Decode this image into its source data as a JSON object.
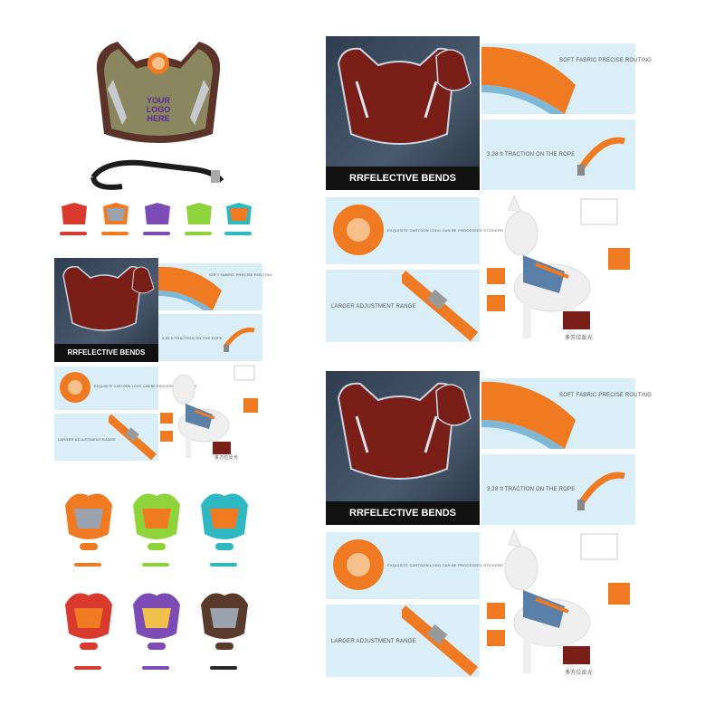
{
  "product": {
    "logo_badge": [
      "YOUR",
      "LOGO",
      "HERE"
    ]
  },
  "detail_panel": {
    "reflective_label": "RRFELECTIVE BENDS",
    "fabric_label": "SOFT FABRIC PRECISE ROUTING",
    "traction_label": "3.28 ft TRACTION ON THE ROPE",
    "sticker_label": "EXQUISITE CARTOON LOGO CAN BE PROCESSED STICKERS",
    "adjust_label": "LARGER ADJUSTMENT RANGE",
    "chinese_label": "多方位反光"
  },
  "colors": {
    "red": "#d93a2e",
    "orange": "#f07a22",
    "purple": "#7c4bb5",
    "green": "#8fd33a",
    "teal": "#2fb8c2",
    "brown": "#5a3a2a",
    "grey": "#9aa3ad",
    "khaki": "#8a8660",
    "dark": "#2f3d4f"
  }
}
